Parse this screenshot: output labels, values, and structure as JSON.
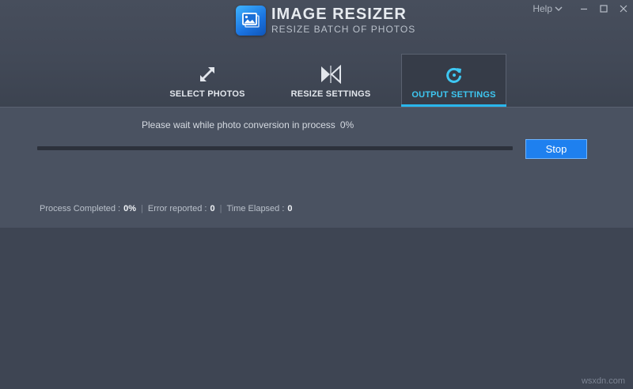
{
  "app": {
    "title": "IMAGE RESIZER",
    "subtitle": "RESIZE BATCH OF PHOTOS",
    "logo_icon": "photos-stack-icon",
    "accent_color": "#29b6ec",
    "button_color": "#1e80ef"
  },
  "window": {
    "help_label": "Help",
    "minimize_icon": "minimize-icon",
    "maximize_icon": "maximize-icon",
    "close_icon": "close-icon"
  },
  "tabs": [
    {
      "label": "SELECT PHOTOS",
      "icon": "expand-arrows-icon",
      "active": false
    },
    {
      "label": "RESIZE SETTINGS",
      "icon": "resize-arrows-icon",
      "active": false
    },
    {
      "label": "OUTPUT SETTINGS",
      "icon": "refresh-icon",
      "active": true
    }
  ],
  "progress": {
    "message": "Please wait while photo conversion in process",
    "percent_text": "0%",
    "fraction": 0,
    "stop_label": "Stop"
  },
  "stats": {
    "completed_label": "Process Completed :",
    "completed_value": "0%",
    "errors_label": "Error reported :",
    "errors_value": "0",
    "elapsed_label": "Time Elapsed :",
    "elapsed_value": "0",
    "separator": "|"
  },
  "watermark": "wsxdn.com"
}
